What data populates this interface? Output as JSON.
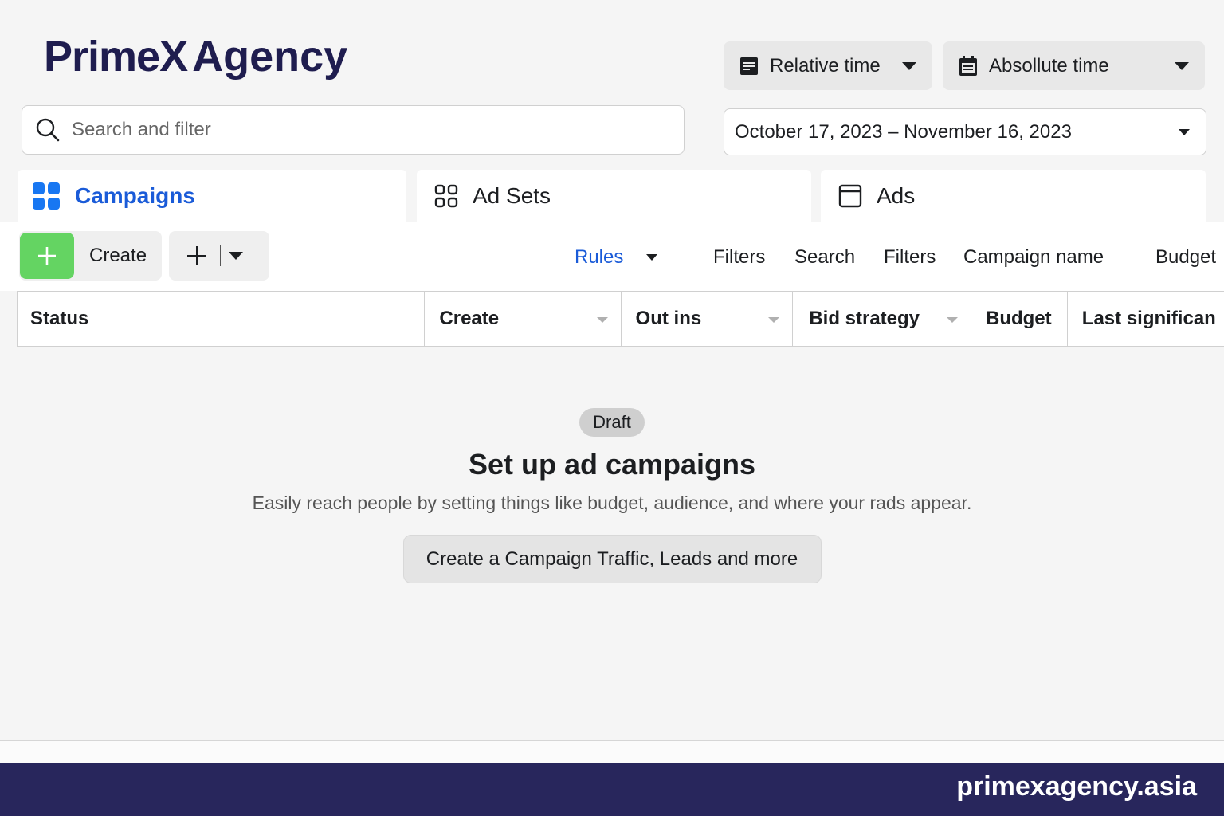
{
  "brand": {
    "name": "PrimeX",
    "suffix": "Agency"
  },
  "time_controls": {
    "relative_label": "Relative time",
    "absolute_label": "Absollute time",
    "date_range": "October 17, 2023 – November 16, 2023"
  },
  "search": {
    "placeholder": "Search and filter"
  },
  "tabs": [
    {
      "label": "Campaigns",
      "active": true
    },
    {
      "label": "Ad Sets",
      "active": false
    },
    {
      "label": "Ads",
      "active": false
    }
  ],
  "toolbar": {
    "create_label": "Create",
    "rules_label": "Rules",
    "items": [
      "Filters",
      "Search",
      "Filters",
      "Campaign name",
      "Budget"
    ]
  },
  "table": {
    "columns": [
      "Status",
      "Create",
      "Out ins",
      "Bid strategy",
      "Budget",
      "Last significan"
    ]
  },
  "empty_state": {
    "badge": "Draft",
    "title": "Set up ad campaigns",
    "subtitle": "Easily reach people by setting things like budget, audience, and where your rads appear.",
    "cta_label": "Create a Campaign Traffic, Leads and more"
  },
  "footer": {
    "url": "primexagency.asia"
  },
  "colors": {
    "accent": "#1a5bd8",
    "create": "#64d462",
    "brand": "#1f1d4f",
    "footer": "#28265c"
  }
}
